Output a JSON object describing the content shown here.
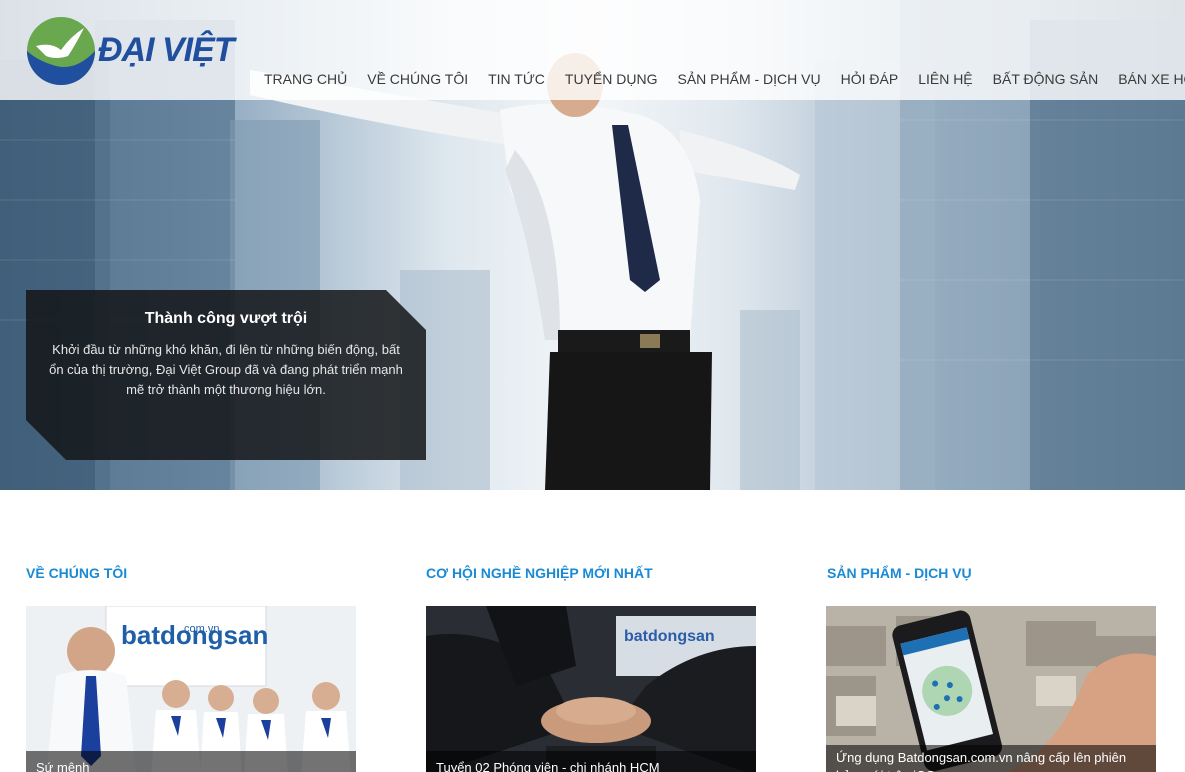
{
  "brand": {
    "name": "ĐẠI VIỆT",
    "logo_icon": "bird-globe-icon",
    "primary_color": "#1f4f9e",
    "accent_color": "#6aa84f"
  },
  "nav": {
    "items": [
      {
        "label": "TRANG CHỦ"
      },
      {
        "label": "VỀ CHÚNG TÔI"
      },
      {
        "label": "TIN TỨC"
      },
      {
        "label": "TUYỂN DỤNG"
      },
      {
        "label": "SẢN PHẨM - DỊCH VỤ"
      },
      {
        "label": "HỎI ĐÁP"
      },
      {
        "label": "LIÊN HỆ"
      },
      {
        "label": "BẤT ĐỘNG SẢN"
      },
      {
        "label": "BÁN XE HƠI"
      }
    ]
  },
  "hero": {
    "title": "Thành công vượt trội",
    "text": "Khởi đầu từ những khó khăn, đi lên từ những biến động, bất ổn của thị trường, Đại Việt Group đã và đang phát triển mạnh mẽ trở thành một thương hiệu lớn."
  },
  "sections": [
    {
      "heading": "VỀ CHÚNG TÔI",
      "image_sign_text": "batdongsan",
      "image_sign_domain": ".com.vn",
      "caption": "Sứ mệnh"
    },
    {
      "heading": "CƠ HỘI NGHỀ NGHIỆP MỚI NHẤT",
      "image_sign_text": "batdongsan",
      "caption": "Tuyển 02 Phóng viên - chi nhánh HCM"
    },
    {
      "heading": "SẢN PHẨM - DỊCH VỤ",
      "caption": "Ứng dụng Batdongsan.com.vn nâng cấp lên phiên bản mới trên iOS"
    }
  ],
  "colors": {
    "section_heading": "#1a8ad4",
    "caption_bg": "#141619"
  }
}
